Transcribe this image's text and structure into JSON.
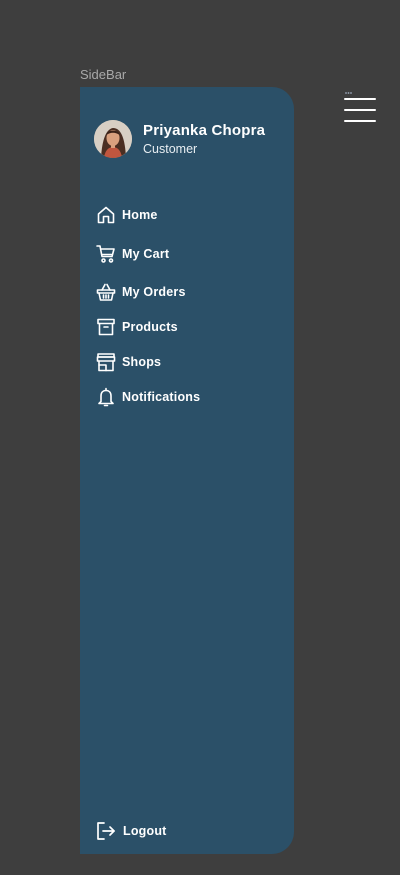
{
  "frame": {
    "label": "SideBar"
  },
  "profile": {
    "name": "Priyanka Chopra",
    "role": "Customer"
  },
  "nav": [
    {
      "label": "Home",
      "icon": "home-icon"
    },
    {
      "label": "My Cart",
      "icon": "cart-icon"
    },
    {
      "label": "My Orders",
      "icon": "basket-icon"
    },
    {
      "label": "Products",
      "icon": "archive-box-icon"
    },
    {
      "label": "Shops",
      "icon": "storefront-icon"
    },
    {
      "label": "Notifications",
      "icon": "bell-icon"
    }
  ],
  "logout": {
    "label": "Logout",
    "icon": "logout-icon"
  },
  "menu_toggle": {
    "icon": "hamburger-menu-icon"
  },
  "colors": {
    "background": "#3e3e3e",
    "sidebar": "#2b5068",
    "text": "#ffffff"
  }
}
